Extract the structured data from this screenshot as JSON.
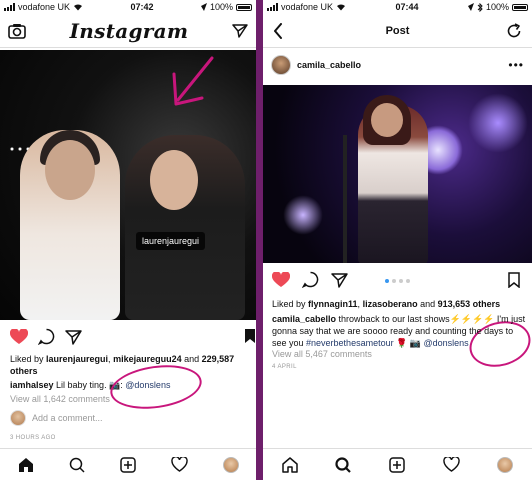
{
  "colors": {
    "accent_pink": "#c8167c",
    "like_red": "#ed4956",
    "link_blue": "#243b6b",
    "divider": "#6e1f6b"
  },
  "left": {
    "status": {
      "carrier": "vodafone UK",
      "time": "07:42",
      "battery": "100%"
    },
    "header": {
      "logo": "Instagram",
      "left_icon": "camera-icon",
      "right_icon": "send-icon"
    },
    "photo": {
      "tag": "laurenjauregui"
    },
    "liked_by": {
      "prefix": "Liked by ",
      "user1": "laurenjauregui",
      "sep": ", ",
      "user2": "mikejaureguu24",
      "and": " and ",
      "count": "229,587",
      "suffix": "others"
    },
    "caption": {
      "user": "iamhalsey",
      "text": " Lil baby ting. 📷: ",
      "handle": "@donslens"
    },
    "view_comments": "View all 1,642 comments",
    "add_comment": "Add a comment...",
    "time_ago": "3 HOURS AGO",
    "tabs": [
      "home-icon",
      "search-icon",
      "add-icon",
      "heart-icon",
      "profile-avatar"
    ]
  },
  "right": {
    "status": {
      "carrier": "vodafone UK",
      "time": "07:44",
      "battery": "100%"
    },
    "header": {
      "title": "Post"
    },
    "post": {
      "username": "camila_cabello"
    },
    "liked_by": {
      "prefix": "Liked by ",
      "user1": "flynnagin11",
      "sep": ", ",
      "user2": "lizasoberano",
      "and": " and ",
      "count": "913,653 others"
    },
    "caption": {
      "user": "camila_cabello",
      "text": " throwback to our last shows⚡⚡⚡⚡ I'm just gonna say that we are soooo ready and counting the days to see you ",
      "hashtag": "#neverbethesametour",
      "emoji": " 🌹 📷 ",
      "handle": "@donslens"
    },
    "view_comments": "View all 5,467 comments",
    "date": "4 APRIL",
    "tabs": [
      "home-icon",
      "search-icon",
      "add-icon",
      "heart-icon",
      "profile-avatar"
    ]
  }
}
